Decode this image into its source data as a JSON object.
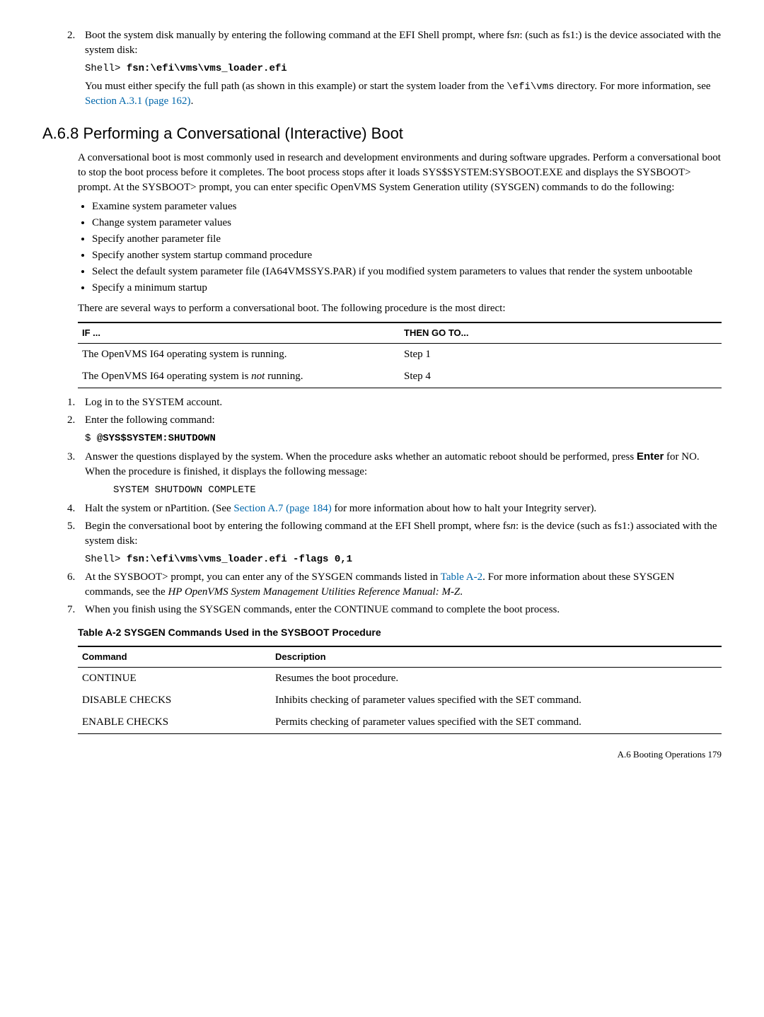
{
  "step2": {
    "text1": "Boot the system disk manually by entering the following command at the EFI Shell prompt, where fs",
    "text1_n": "n",
    "text1_after": ": (such as fs1:) is the device associated with the system disk:",
    "shell_prompt": "Shell> ",
    "shell_cmd": "fsn:\\efi\\vms\\vms_loader.efi",
    "text2_a": "You must either specify the full path (as shown in this example) or start the system loader from the ",
    "text2_code": "\\efi\\vms",
    "text2_b": " directory. For more information, see ",
    "text2_link": "Section A.3.1 (page 162)",
    "text2_c": "."
  },
  "sectionHeading": "A.6.8  Performing a Conversational (Interactive) Boot",
  "paraConv": "A conversational boot is most commonly used in research and development environments and during software upgrades. Perform a conversational boot to stop the boot process before it completes. The boot process stops after it loads SYS$SYSTEM:SYSBOOT.EXE and displays the SYSBOOT> prompt. At the SYSBOOT> prompt, you can enter specific OpenVMS System Generation utility (SYSGEN) commands to do the following:",
  "bullets": [
    "Examine system parameter values",
    "Change system parameter values",
    "Specify another parameter file",
    "Specify another system startup command procedure",
    "Select the default system parameter file (IA64VMSSYS.PAR) if you modified system parameters to values that render the system unbootable",
    "Specify a minimum startup"
  ],
  "paraWays": "There are several ways to perform a conversational boot. The following procedure is the most direct:",
  "ifthen": {
    "h1": "IF ...",
    "h2": "THEN GO TO...",
    "r1c1": "The OpenVMS I64 operating system is running.",
    "r1c2": "Step 1",
    "r2c1_a": "The OpenVMS I64 operating system is ",
    "r2c1_not": "not",
    "r2c1_b": " running.",
    "r2c2": "Step 4"
  },
  "steps": {
    "s1": "Log in to the SYSTEM account.",
    "s2": "Enter the following command:",
    "s2_prompt": "$ ",
    "s2_cmd": "@SYS$SYSTEM:SHUTDOWN",
    "s3_a": "Answer the questions displayed by the system. When the procedure asks whether an automatic reboot should be performed, press ",
    "s3_enter": "Enter",
    "s3_b": " for NO. When the procedure is finished, it displays the following message:",
    "s3_msg": "SYSTEM SHUTDOWN COMPLETE",
    "s4_a": "Halt the system or nPartition. (See ",
    "s4_link": "Section A.7 (page 184)",
    "s4_b": " for more information about how to halt your Integrity server).",
    "s5_a": "Begin the conversational boot by entering the following command at the EFI Shell prompt, where fs",
    "s5_n": "n",
    "s5_b": ": is the device (such as fs1:) associated with the system disk:",
    "s5_prompt": "Shell> ",
    "s5_cmd": "fsn:\\efi\\vms\\vms_loader.efi -flags 0,1",
    "s6_a": "At the SYSBOOT> prompt, you can enter any of the SYSGEN commands listed in ",
    "s6_link": "Table A-2",
    "s6_b": ". For more information about these SYSGEN commands, see the ",
    "s6_ital": "HP OpenVMS System Management Utilities Reference Manual: M-Z",
    "s6_c": ".",
    "s7": "When you finish using the SYSGEN commands, enter the CONTINUE command to complete the boot process."
  },
  "tableCaption": "Table  A-2  SYSGEN Commands Used in the SYSBOOT Procedure",
  "sysgen": {
    "h1": "Command",
    "h2": "Description",
    "rows": [
      {
        "c": "CONTINUE",
        "d": "Resumes the boot procedure."
      },
      {
        "c": "DISABLE CHECKS",
        "d": "Inhibits checking of parameter values specified with the SET command."
      },
      {
        "c": "ENABLE CHECKS",
        "d": "Permits checking of parameter values specified with the SET command."
      }
    ]
  },
  "footer": "A.6 Booting Operations     179"
}
